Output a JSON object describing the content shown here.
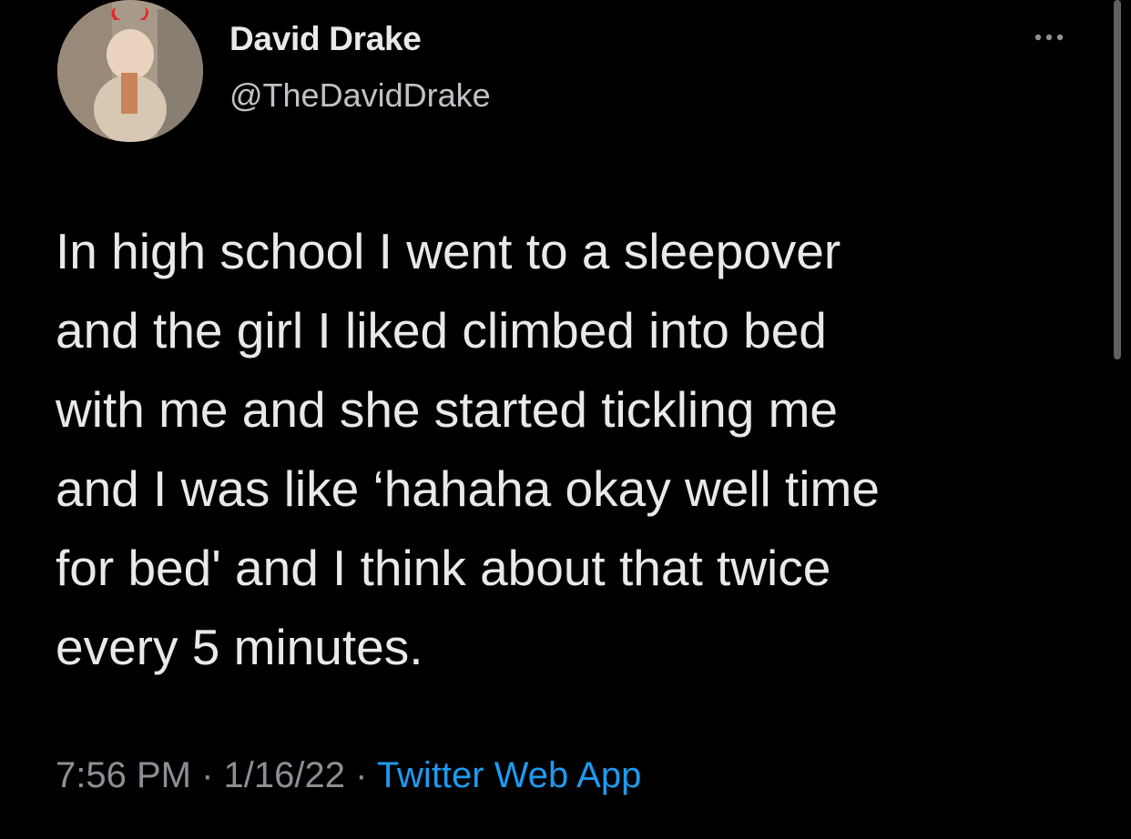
{
  "author": {
    "display_name": "David Drake",
    "handle": "@TheDavidDrake"
  },
  "tweet": {
    "text": "In high school I went to a sleepover\nand the girl I liked climbed into bed\nwith me and she started tickling me\nand I was like ‘hahaha okay well time\nfor bed' and I think about that twice\nevery 5 minutes."
  },
  "meta": {
    "time": "7:56 PM",
    "separator_1": " · ",
    "date": "1/16/22",
    "separator_2": " · ",
    "source": "Twitter Web App"
  },
  "icons": {
    "more": "more-horizontal-icon"
  },
  "colors": {
    "background": "#000000",
    "text": "#e7e9ea",
    "muted": "#8b9096",
    "link": "#1d9bf0"
  }
}
